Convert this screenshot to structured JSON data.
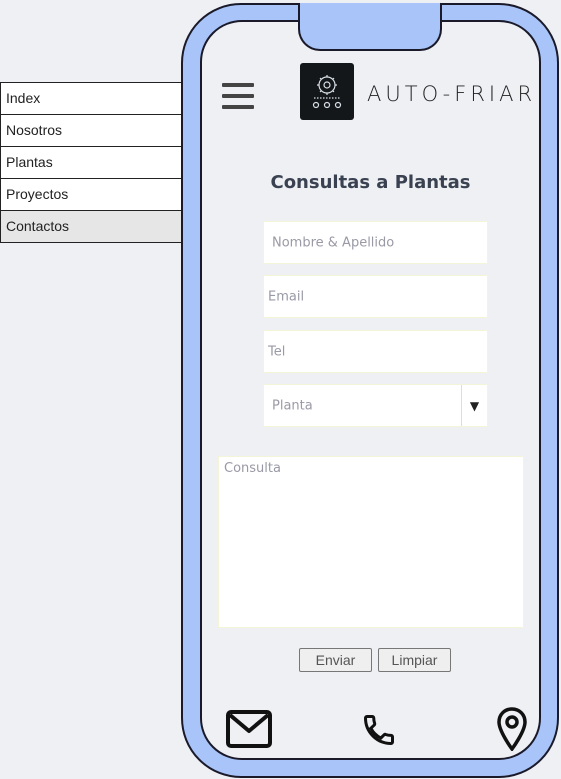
{
  "menu": {
    "items": [
      {
        "label": "Index"
      },
      {
        "label": "Nosotros"
      },
      {
        "label": "Plantas"
      },
      {
        "label": "Proyectos"
      },
      {
        "label": "Contactos",
        "active": true
      }
    ]
  },
  "header": {
    "menu_icon": "hamburger-icon",
    "logo_icon": "gear-network-icon",
    "brand": "AUTO-FRIAR"
  },
  "form": {
    "title": "Consultas a Plantas",
    "name_placeholder": "Nombre & Apellido",
    "email_placeholder": "Email",
    "tel_placeholder": "Tel",
    "planta_placeholder": "Planta",
    "consulta_placeholder": "Consulta",
    "submit_label": "Enviar",
    "reset_label": "Limpiar"
  },
  "footer": {
    "icons": [
      "mail-icon",
      "phone-icon",
      "location-pin-icon"
    ]
  },
  "colors": {
    "phone_frame": "#a8c4f8",
    "screen_bg": "#eef0f4",
    "logo_bg": "#14171a"
  }
}
